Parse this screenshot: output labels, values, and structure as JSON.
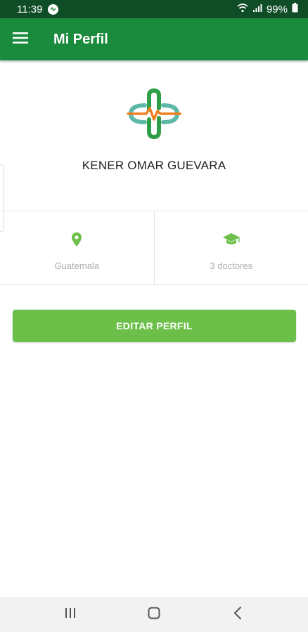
{
  "status_bar": {
    "time": "11:39",
    "battery": "99%",
    "icons": [
      "notification-icon",
      "wifi-icon",
      "signal-icon",
      "battery-icon"
    ]
  },
  "app_bar": {
    "title": "Mi Perfil",
    "menu_icon": "menu-icon",
    "background_color": "#1a8a3c"
  },
  "profile": {
    "logo": "medical-cross-logo",
    "name": "KENER OMAR GUEVARA"
  },
  "info": {
    "location": {
      "icon": "location-pin-icon",
      "text": "Guatemala"
    },
    "doctors": {
      "icon": "graduation-cap-icon",
      "text": "3 doctores"
    }
  },
  "actions": {
    "edit_label": "EDITAR PERFIL",
    "button_color": "#6cc04a"
  },
  "nav_bar": {
    "icons": [
      "recent-apps-icon",
      "home-icon",
      "back-icon"
    ]
  }
}
